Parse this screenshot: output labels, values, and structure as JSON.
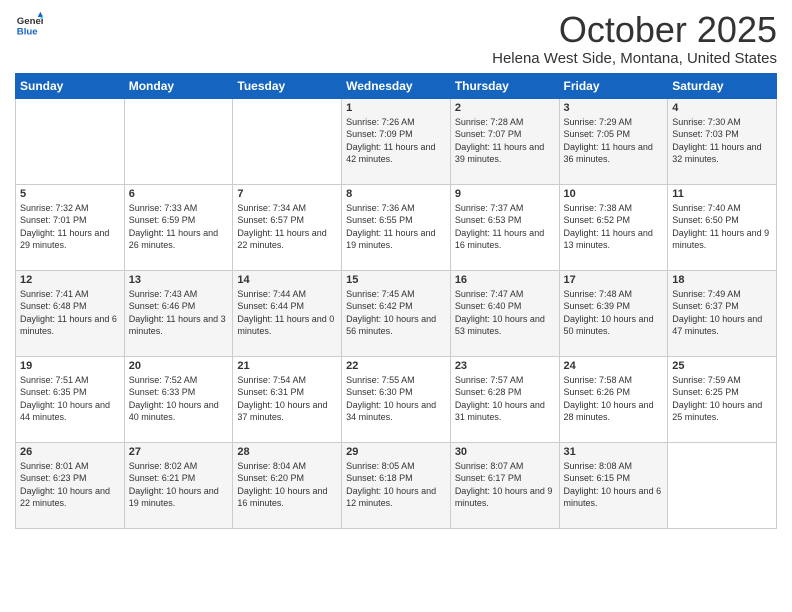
{
  "logo": {
    "general": "General",
    "blue": "Blue"
  },
  "header": {
    "month": "October 2025",
    "location": "Helena West Side, Montana, United States"
  },
  "days_of_week": [
    "Sunday",
    "Monday",
    "Tuesday",
    "Wednesday",
    "Thursday",
    "Friday",
    "Saturday"
  ],
  "weeks": [
    [
      {
        "day": "",
        "sunrise": "",
        "sunset": "",
        "daylight": ""
      },
      {
        "day": "",
        "sunrise": "",
        "sunset": "",
        "daylight": ""
      },
      {
        "day": "",
        "sunrise": "",
        "sunset": "",
        "daylight": ""
      },
      {
        "day": "1",
        "sunrise": "Sunrise: 7:26 AM",
        "sunset": "Sunset: 7:09 PM",
        "daylight": "Daylight: 11 hours and 42 minutes."
      },
      {
        "day": "2",
        "sunrise": "Sunrise: 7:28 AM",
        "sunset": "Sunset: 7:07 PM",
        "daylight": "Daylight: 11 hours and 39 minutes."
      },
      {
        "day": "3",
        "sunrise": "Sunrise: 7:29 AM",
        "sunset": "Sunset: 7:05 PM",
        "daylight": "Daylight: 11 hours and 36 minutes."
      },
      {
        "day": "4",
        "sunrise": "Sunrise: 7:30 AM",
        "sunset": "Sunset: 7:03 PM",
        "daylight": "Daylight: 11 hours and 32 minutes."
      }
    ],
    [
      {
        "day": "5",
        "sunrise": "Sunrise: 7:32 AM",
        "sunset": "Sunset: 7:01 PM",
        "daylight": "Daylight: 11 hours and 29 minutes."
      },
      {
        "day": "6",
        "sunrise": "Sunrise: 7:33 AM",
        "sunset": "Sunset: 6:59 PM",
        "daylight": "Daylight: 11 hours and 26 minutes."
      },
      {
        "day": "7",
        "sunrise": "Sunrise: 7:34 AM",
        "sunset": "Sunset: 6:57 PM",
        "daylight": "Daylight: 11 hours and 22 minutes."
      },
      {
        "day": "8",
        "sunrise": "Sunrise: 7:36 AM",
        "sunset": "Sunset: 6:55 PM",
        "daylight": "Daylight: 11 hours and 19 minutes."
      },
      {
        "day": "9",
        "sunrise": "Sunrise: 7:37 AM",
        "sunset": "Sunset: 6:53 PM",
        "daylight": "Daylight: 11 hours and 16 minutes."
      },
      {
        "day": "10",
        "sunrise": "Sunrise: 7:38 AM",
        "sunset": "Sunset: 6:52 PM",
        "daylight": "Daylight: 11 hours and 13 minutes."
      },
      {
        "day": "11",
        "sunrise": "Sunrise: 7:40 AM",
        "sunset": "Sunset: 6:50 PM",
        "daylight": "Daylight: 11 hours and 9 minutes."
      }
    ],
    [
      {
        "day": "12",
        "sunrise": "Sunrise: 7:41 AM",
        "sunset": "Sunset: 6:48 PM",
        "daylight": "Daylight: 11 hours and 6 minutes."
      },
      {
        "day": "13",
        "sunrise": "Sunrise: 7:43 AM",
        "sunset": "Sunset: 6:46 PM",
        "daylight": "Daylight: 11 hours and 3 minutes."
      },
      {
        "day": "14",
        "sunrise": "Sunrise: 7:44 AM",
        "sunset": "Sunset: 6:44 PM",
        "daylight": "Daylight: 11 hours and 0 minutes."
      },
      {
        "day": "15",
        "sunrise": "Sunrise: 7:45 AM",
        "sunset": "Sunset: 6:42 PM",
        "daylight": "Daylight: 10 hours and 56 minutes."
      },
      {
        "day": "16",
        "sunrise": "Sunrise: 7:47 AM",
        "sunset": "Sunset: 6:40 PM",
        "daylight": "Daylight: 10 hours and 53 minutes."
      },
      {
        "day": "17",
        "sunrise": "Sunrise: 7:48 AM",
        "sunset": "Sunset: 6:39 PM",
        "daylight": "Daylight: 10 hours and 50 minutes."
      },
      {
        "day": "18",
        "sunrise": "Sunrise: 7:49 AM",
        "sunset": "Sunset: 6:37 PM",
        "daylight": "Daylight: 10 hours and 47 minutes."
      }
    ],
    [
      {
        "day": "19",
        "sunrise": "Sunrise: 7:51 AM",
        "sunset": "Sunset: 6:35 PM",
        "daylight": "Daylight: 10 hours and 44 minutes."
      },
      {
        "day": "20",
        "sunrise": "Sunrise: 7:52 AM",
        "sunset": "Sunset: 6:33 PM",
        "daylight": "Daylight: 10 hours and 40 minutes."
      },
      {
        "day": "21",
        "sunrise": "Sunrise: 7:54 AM",
        "sunset": "Sunset: 6:31 PM",
        "daylight": "Daylight: 10 hours and 37 minutes."
      },
      {
        "day": "22",
        "sunrise": "Sunrise: 7:55 AM",
        "sunset": "Sunset: 6:30 PM",
        "daylight": "Daylight: 10 hours and 34 minutes."
      },
      {
        "day": "23",
        "sunrise": "Sunrise: 7:57 AM",
        "sunset": "Sunset: 6:28 PM",
        "daylight": "Daylight: 10 hours and 31 minutes."
      },
      {
        "day": "24",
        "sunrise": "Sunrise: 7:58 AM",
        "sunset": "Sunset: 6:26 PM",
        "daylight": "Daylight: 10 hours and 28 minutes."
      },
      {
        "day": "25",
        "sunrise": "Sunrise: 7:59 AM",
        "sunset": "Sunset: 6:25 PM",
        "daylight": "Daylight: 10 hours and 25 minutes."
      }
    ],
    [
      {
        "day": "26",
        "sunrise": "Sunrise: 8:01 AM",
        "sunset": "Sunset: 6:23 PM",
        "daylight": "Daylight: 10 hours and 22 minutes."
      },
      {
        "day": "27",
        "sunrise": "Sunrise: 8:02 AM",
        "sunset": "Sunset: 6:21 PM",
        "daylight": "Daylight: 10 hours and 19 minutes."
      },
      {
        "day": "28",
        "sunrise": "Sunrise: 8:04 AM",
        "sunset": "Sunset: 6:20 PM",
        "daylight": "Daylight: 10 hours and 16 minutes."
      },
      {
        "day": "29",
        "sunrise": "Sunrise: 8:05 AM",
        "sunset": "Sunset: 6:18 PM",
        "daylight": "Daylight: 10 hours and 12 minutes."
      },
      {
        "day": "30",
        "sunrise": "Sunrise: 8:07 AM",
        "sunset": "Sunset: 6:17 PM",
        "daylight": "Daylight: 10 hours and 9 minutes."
      },
      {
        "day": "31",
        "sunrise": "Sunrise: 8:08 AM",
        "sunset": "Sunset: 6:15 PM",
        "daylight": "Daylight: 10 hours and 6 minutes."
      },
      {
        "day": "",
        "sunrise": "",
        "sunset": "",
        "daylight": ""
      }
    ]
  ]
}
